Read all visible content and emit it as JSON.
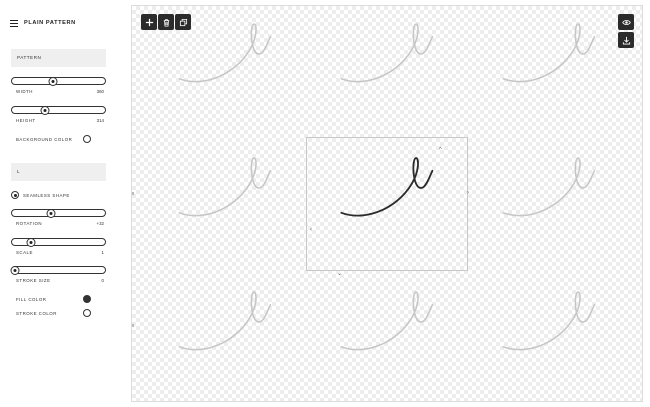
{
  "app": {
    "title": "PLAIN PATTERN"
  },
  "sidebar": {
    "pattern_select": "PATTERN",
    "width": {
      "label": "WIDTH",
      "value": "360",
      "fraction": 0.44
    },
    "height": {
      "label": "HEIGHT",
      "value": "314",
      "fraction": 0.36
    },
    "background_color": {
      "label": "BACKGROUND COLOR"
    },
    "shape_select": "L",
    "seamless_shape": {
      "label": "SEAMLESS SHAPE",
      "checked": true
    },
    "rotation": {
      "label": "ROTATION",
      "value": "+32",
      "fraction": 0.42
    },
    "scale": {
      "label": "SCALE",
      "value": "1",
      "fraction": 0.2
    },
    "stroke_size": {
      "label": "STROKE SIZE",
      "value": "0",
      "fraction": 0.03
    },
    "fill_color": {
      "label": "FILL COLOR",
      "color": "#333333"
    },
    "stroke_color": {
      "label": "STROKE COLOR",
      "color": "#ffffff"
    }
  },
  "toolbar": {
    "left": [
      {
        "name": "add-icon"
      },
      {
        "name": "trash-icon"
      },
      {
        "name": "duplicate-icon"
      }
    ],
    "right": [
      {
        "name": "eye-icon"
      },
      {
        "name": "download-icon"
      }
    ]
  },
  "canvas": {
    "shape_color": "#2b2b2b",
    "ghost_color": "#c6c6c6"
  }
}
